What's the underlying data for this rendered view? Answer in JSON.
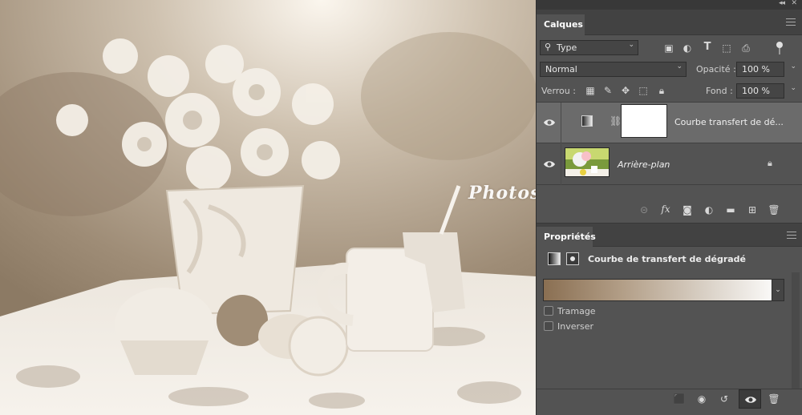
{
  "canvas": {
    "watermark": "Photoshoplus"
  },
  "layers_panel": {
    "tab_label": "Calques",
    "filter": {
      "value": "Type"
    },
    "blend_mode": {
      "value": "Normal"
    },
    "opacity": {
      "label": "Opacité :",
      "value": "100 %"
    },
    "lock": {
      "label": "Verrou :"
    },
    "fill": {
      "label": "Fond :",
      "value": "100 %"
    },
    "layers": [
      {
        "name": "Courbe transfert de dé...",
        "selected": true
      },
      {
        "name": "Arrière-plan",
        "selected": false
      }
    ]
  },
  "properties_panel": {
    "tab_label": "Propriétés",
    "title": "Courbe de transfert de dégradé",
    "gradient_colors": [
      "#8a6f52",
      "#b39f88",
      "#d8cfc4",
      "#ffffff"
    ],
    "options": [
      {
        "label": "Tramage",
        "checked": false
      },
      {
        "label": "Inverser",
        "checked": false
      }
    ]
  },
  "icons": {
    "collapse": "double-chevron-icon",
    "eye": "eye-icon",
    "lock": "lock-icon",
    "link": "link-icon"
  },
  "colors": {
    "panel_bg": "#535353",
    "selected_row": "#6b6b6b",
    "sepia_dark": "#8a6f52"
  }
}
